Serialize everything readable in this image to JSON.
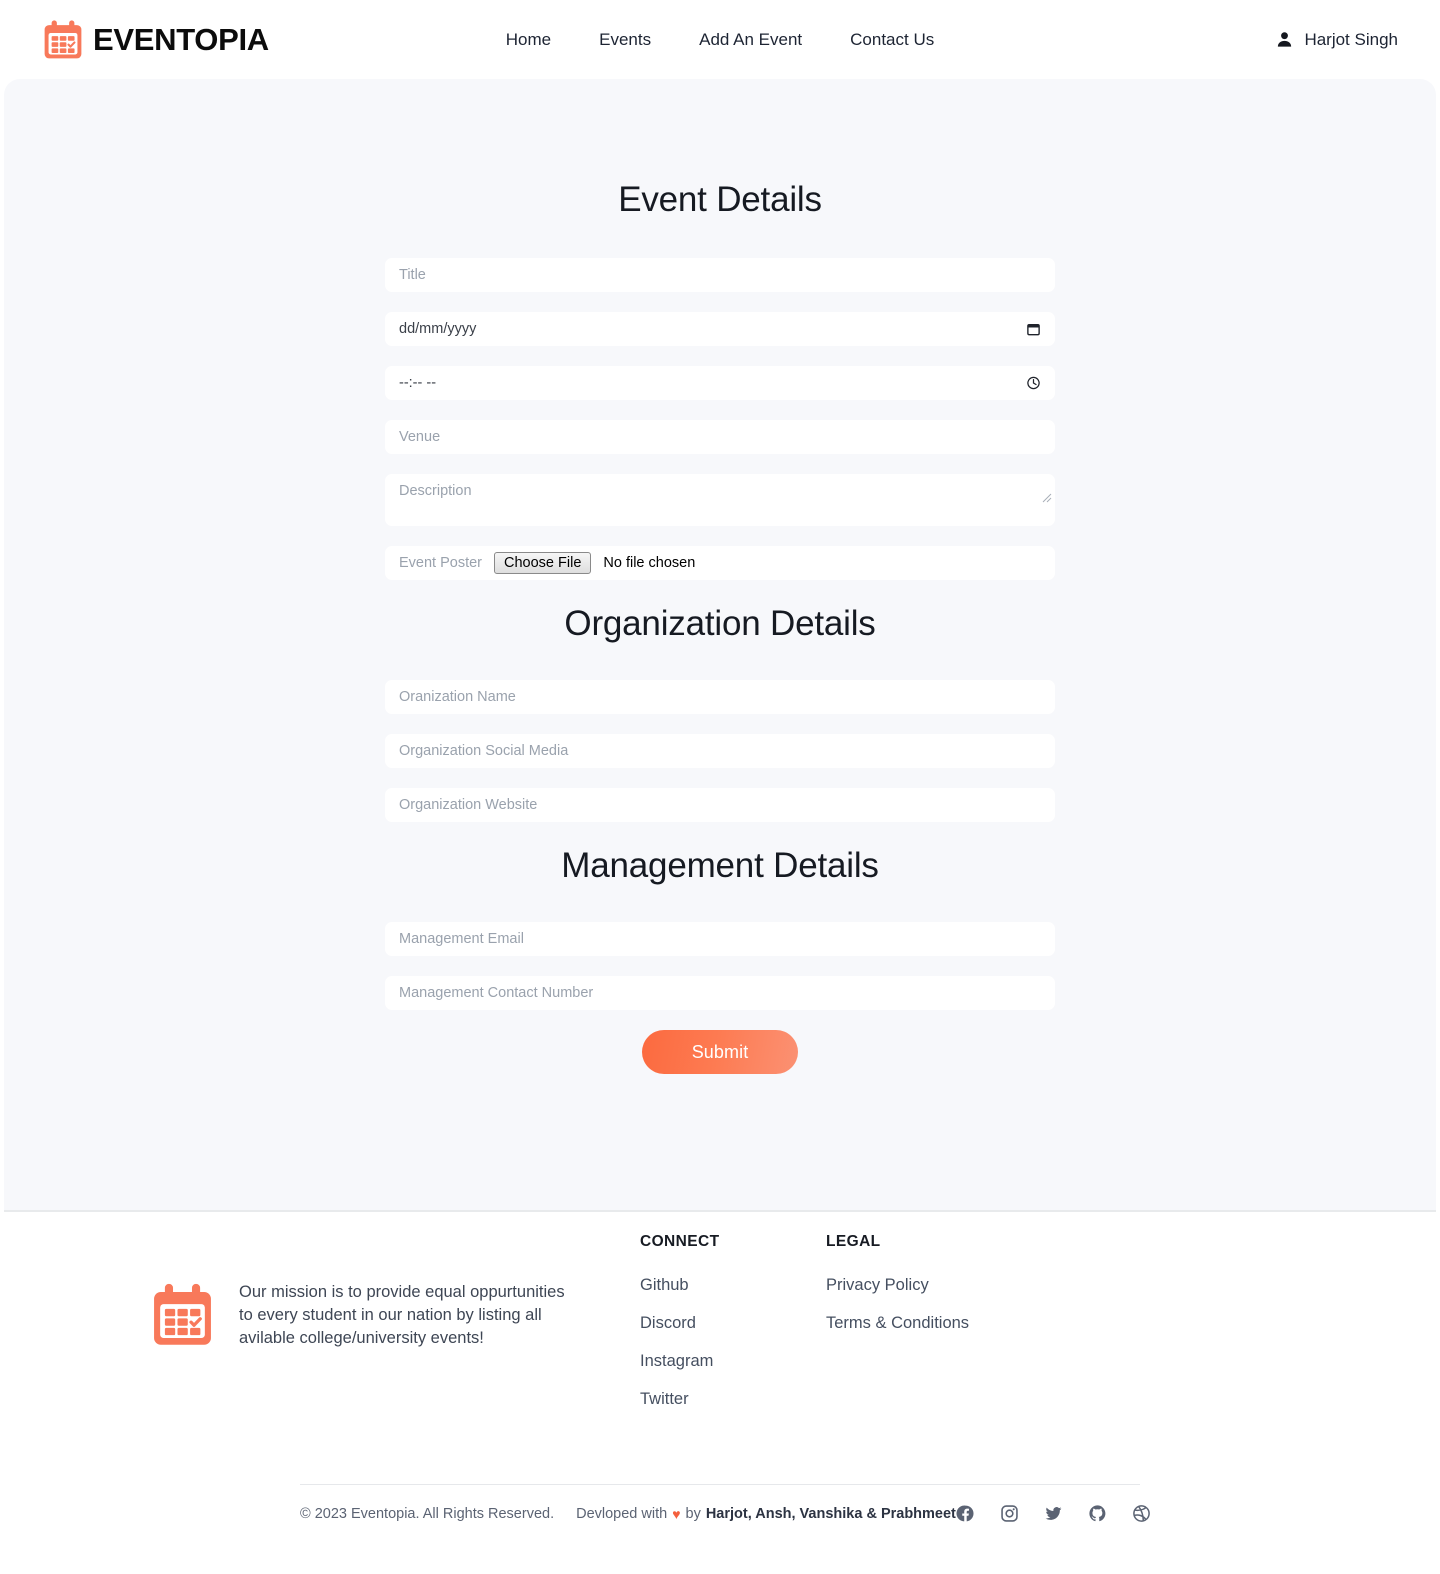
{
  "header": {
    "brand_name": "EVENTOPIA",
    "brand_icon": "calendar-icon",
    "nav": [
      {
        "label": "Home"
      },
      {
        "label": "Events"
      },
      {
        "label": "Add An Event"
      },
      {
        "label": "Contact Us"
      }
    ],
    "user": {
      "name": "Harjot Singh",
      "icon": "user-icon"
    }
  },
  "main": {
    "event_section_title": "Event Details",
    "organization_section_title": "Organization Details",
    "management_section_title": "Management Details",
    "fields": {
      "title_placeholder": "Title",
      "date_value": "dd/mm/yyyy",
      "time_value": "--:-- --",
      "venue_placeholder": "Venue",
      "description_placeholder": "Description",
      "poster_label": "Event Poster",
      "poster_button": "Choose File",
      "poster_status": "No file chosen",
      "org_name_placeholder": "Oranization Name",
      "org_social_placeholder": "Organization Social Media",
      "org_website_placeholder": "Organization Website",
      "mgmt_email_placeholder": "Management Email",
      "mgmt_contact_placeholder": "Management Contact Number"
    },
    "submit_label": "Submit"
  },
  "footer": {
    "brand_icon": "calendar-icon",
    "mission": "Our mission is to provide equal oppurtunities to every student in our nation by listing all avilable college/university events!",
    "columns": [
      {
        "heading": "CONNECT",
        "links": [
          {
            "label": "Github"
          },
          {
            "label": "Discord"
          },
          {
            "label": "Instagram"
          },
          {
            "label": "Twitter"
          }
        ]
      },
      {
        "heading": "LEGAL",
        "links": [
          {
            "label": "Privacy Policy"
          },
          {
            "label": "Terms & Conditions"
          }
        ]
      }
    ],
    "copyright": "© 2023 Eventopia. All Rights Reserved.",
    "credit_prefix": "Devloped with",
    "credit_heart": "♥",
    "credit_by": "by",
    "credit_names": "Harjot, Ansh, Vanshika & Prabhmeet",
    "social": [
      {
        "name": "facebook-icon"
      },
      {
        "name": "instagram-icon"
      },
      {
        "name": "twitter-icon"
      },
      {
        "name": "github-icon"
      },
      {
        "name": "dribbble-icon"
      }
    ]
  },
  "colors": {
    "accent": "#fc6a3f",
    "accent_light": "#fb9173",
    "page_bg": "#f7f8fb",
    "text_dark": "#1d2433",
    "text_muted": "#5b6373",
    "placeholder": "#9aa2ad"
  }
}
